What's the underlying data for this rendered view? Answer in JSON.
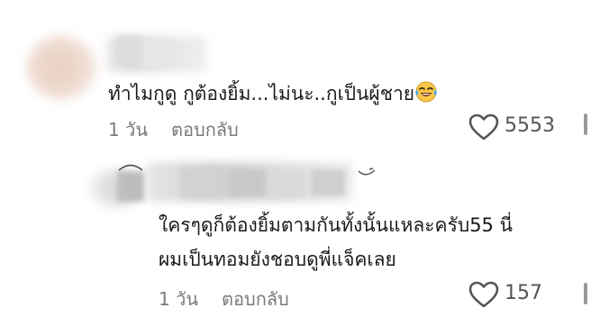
{
  "comments": [
    {
      "text": "ทำไมกูดู กูต้องยิ้ม...ไม่นะ..กูเป็นผู้ชาย",
      "emoji": "tears-of-joy-emoji",
      "time": "1 วัน",
      "reply": "ตอบกลับ",
      "likes": "5553"
    },
    {
      "line1": "ใครๆดูก็ต้องยิ้มตามกันทั้งนั้นแหละครับ55 นี่",
      "line2": "ผมเป็นทอมยังชอบดูพี่แจ็คเลย",
      "time": "1 วัน",
      "reply": "ตอบกลับ",
      "likes": "157"
    }
  ],
  "colors": {
    "text": "#1a1a1a",
    "meta": "#7a7a7a",
    "heart": "#555555"
  }
}
